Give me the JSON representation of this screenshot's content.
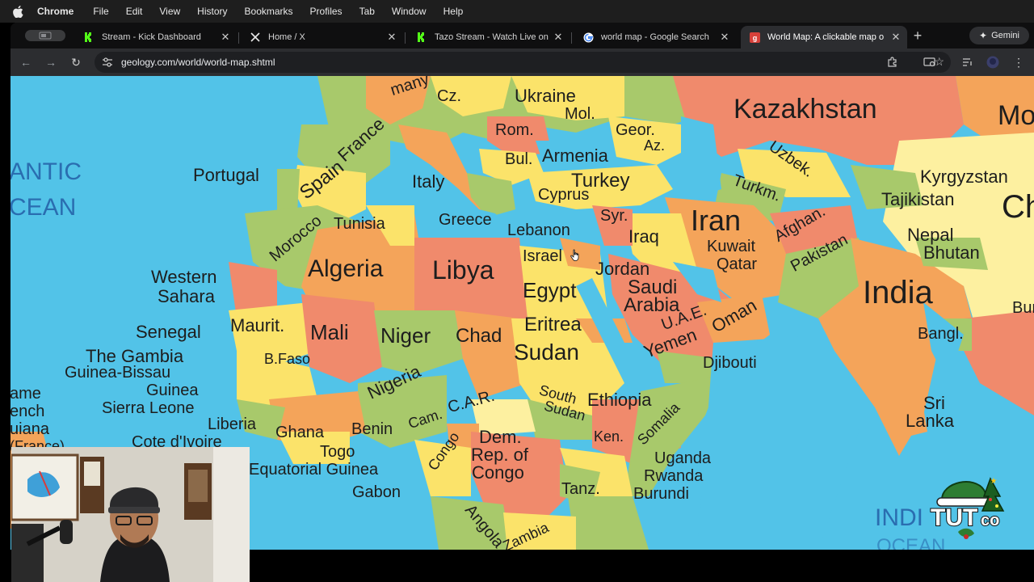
{
  "menubar": {
    "app_name": "Chrome",
    "items": [
      "File",
      "Edit",
      "View",
      "History",
      "Bookmarks",
      "Profiles",
      "Tab",
      "Window",
      "Help"
    ]
  },
  "tabs": [
    {
      "title": "Stream - Kick Dashboard",
      "favicon": "kick-icon",
      "active": false
    },
    {
      "title": "Home / X",
      "favicon": "x-icon",
      "active": false
    },
    {
      "title": "Tazo Stream - Watch Live on",
      "favicon": "kick-icon",
      "active": false
    },
    {
      "title": "world map - Google Search",
      "favicon": "google-icon",
      "active": false
    },
    {
      "title": "World Map: A clickable map o",
      "favicon": "geology-icon",
      "active": true
    }
  ],
  "gemini_label": "Gemini",
  "address_bar": {
    "url": "geology.com/world/world-map.shtml"
  },
  "map": {
    "oceans": [
      "ANTIC",
      "CEAN",
      "INDI",
      "OCEAN"
    ],
    "countries": [
      "many",
      "Cz.",
      "Ukraine",
      "Mol.",
      "Kazakhstan",
      "Mo",
      "Rom.",
      "Geor.",
      "Az.",
      "Bul.",
      "Armenia",
      "France",
      "Portugal",
      "Spain",
      "Italy",
      "Turkey",
      "Cyprus",
      "Uzbek.",
      "Kyrgyzstan",
      "Turkm.",
      "Tajikistan",
      "Ch",
      "Greece",
      "Tunisia",
      "Lebanon",
      "Syr.",
      "Iran",
      "Iraq",
      "Afghan.",
      "Nepal",
      "Bhutan",
      "Morocco",
      "Kuwait",
      "Qatar",
      "Pakistan",
      "Algeria",
      "Libya",
      "Israel",
      "Jordan",
      "Western",
      "Sahara",
      "Egypt",
      "Saudi",
      "Arabia",
      "India",
      "U.A.E.",
      "Oman",
      "Bur",
      "Senegal",
      "Maurit.",
      "Mali",
      "Niger",
      "Chad",
      "Eritrea",
      "Yemen",
      "The Gambia",
      "B.Faso",
      "Sudan",
      "Djibouti",
      "Bangl.",
      "Guinea-Bissau",
      "Guinea",
      "Nigeria",
      "South",
      "Sudan",
      "Ethiopia",
      "Sierra Leone",
      "C.A.R.",
      "Sri",
      "Lanka",
      "Liberia",
      "Benin",
      "Cam.",
      "Somalia",
      "Cote d'Ivoire",
      "Ghana",
      "Dem.",
      "Ken.",
      "Rep. of",
      "Uganda",
      "Togo",
      "Congo",
      "Rwanda",
      "Congo",
      "Equatorial Guinea",
      "Burundi",
      "Gabon",
      "Tanz.",
      "Angola",
      "Zambia",
      "ame",
      "ench",
      "uiana",
      "(France)"
    ]
  },
  "logo": {
    "text": "TUTco"
  },
  "colors": {
    "ocean": "#52c3e8",
    "orange": "#f4a45a",
    "salmon": "#f08a6c",
    "yellow": "#fbe36a",
    "green": "#a8c96b",
    "pale_yellow": "#fdf0a0"
  }
}
